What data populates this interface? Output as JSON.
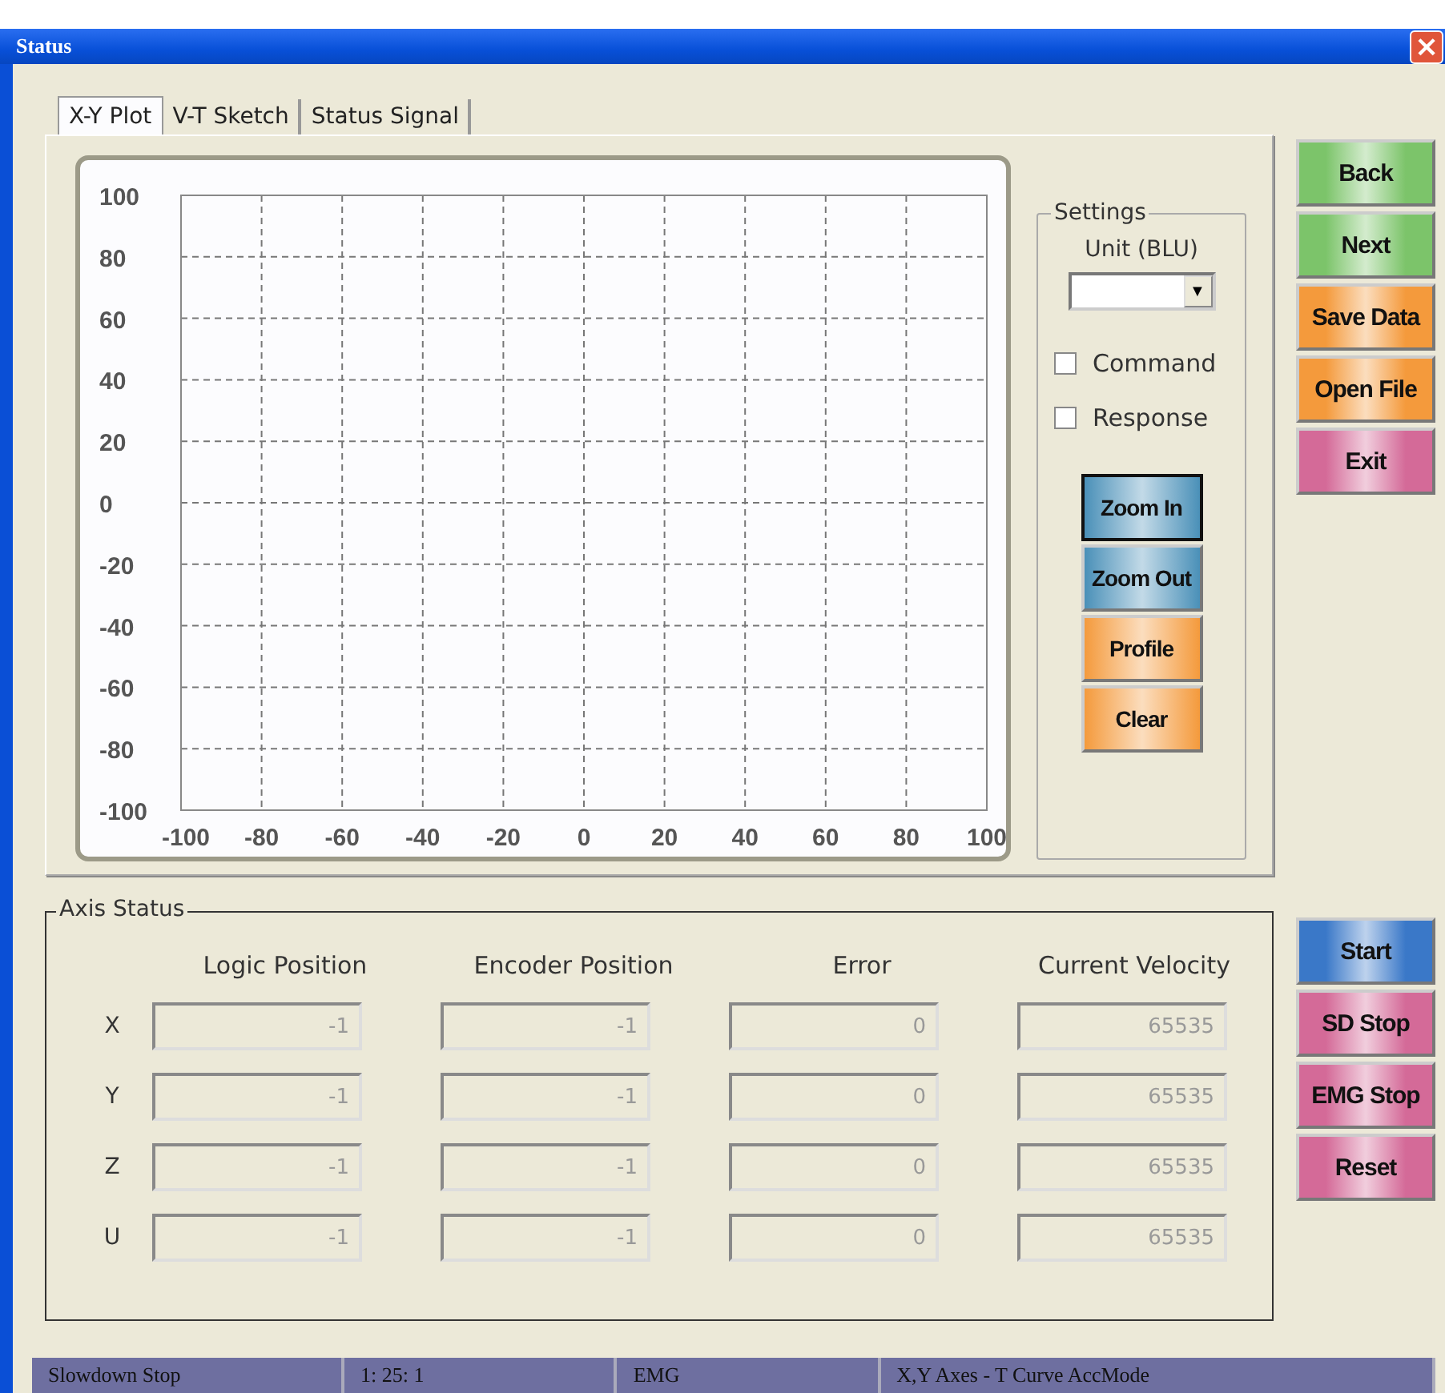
{
  "window": {
    "title": "Status",
    "close": "×"
  },
  "tabs": [
    {
      "label": "X-Y Plot",
      "selected": true
    },
    {
      "label": "V-T Sketch",
      "selected": false
    },
    {
      "label": "Status Signal",
      "selected": false
    }
  ],
  "plot": {
    "chart_data": {
      "type": "scatter",
      "grid": true,
      "xlim": [
        -100,
        100
      ],
      "ylim": [
        -100,
        100
      ],
      "xticks": [
        -100,
        -80,
        -60,
        -40,
        -20,
        0,
        20,
        40,
        60,
        80,
        100
      ],
      "yticks": [
        -100,
        -80,
        -60,
        -40,
        -20,
        0,
        20,
        40,
        60,
        80,
        100
      ]
    }
  },
  "settings": {
    "title": "Settings",
    "unit_label": "Unit (BLU)",
    "unit_arrow": "▼",
    "checkboxes": [
      {
        "label": "Command",
        "checked": false
      },
      {
        "label": "Response",
        "checked": false
      }
    ],
    "buttons": [
      {
        "label": "Zoom In",
        "color": "#4a90b8",
        "selected": true
      },
      {
        "label": "Zoom Out",
        "color": "#4a90b8",
        "selected": false
      },
      {
        "label": "Profile",
        "color": "#f49a3c",
        "selected": false
      },
      {
        "label": "Clear",
        "color": "#f49a3c",
        "selected": false
      }
    ]
  },
  "side_buttons": [
    {
      "label": "Back",
      "color": "#7cc46a"
    },
    {
      "label": "Next",
      "color": "#7cc46a"
    },
    {
      "label": "Save Data",
      "color": "#f49a3c"
    },
    {
      "label": "Open File",
      "color": "#f49a3c"
    },
    {
      "label": "Exit",
      "color": "#d46a98"
    }
  ],
  "axis_status": {
    "title": "Axis Status",
    "columns": [
      "Logic Position",
      "Encoder Position",
      "Error",
      "Current Velocity"
    ],
    "rows": [
      {
        "axis": "X",
        "values": [
          "-1",
          "-1",
          "0",
          "65535"
        ],
        "disabled": true
      },
      {
        "axis": "Y",
        "values": [
          "-1",
          "-1",
          "0",
          "65535"
        ],
        "disabled": true
      },
      {
        "axis": "Z",
        "values": [
          "-1",
          "-1",
          "0",
          "65535"
        ],
        "disabled": true
      },
      {
        "axis": "U",
        "values": [
          "-1",
          "-1",
          "0",
          "65535"
        ],
        "disabled": true
      }
    ]
  },
  "motion_buttons": [
    {
      "label": "Start",
      "color": "#3a78c8"
    },
    {
      "label": "SD Stop",
      "color": "#d46a98"
    },
    {
      "label": "EMG Stop",
      "color": "#d46a98"
    },
    {
      "label": "Reset",
      "color": "#d46a98"
    }
  ],
  "status_bar": [
    "Slowdown Stop",
    "1: 25: 1",
    "EMG",
    "X,Y Axes - T Curve AccMode"
  ]
}
